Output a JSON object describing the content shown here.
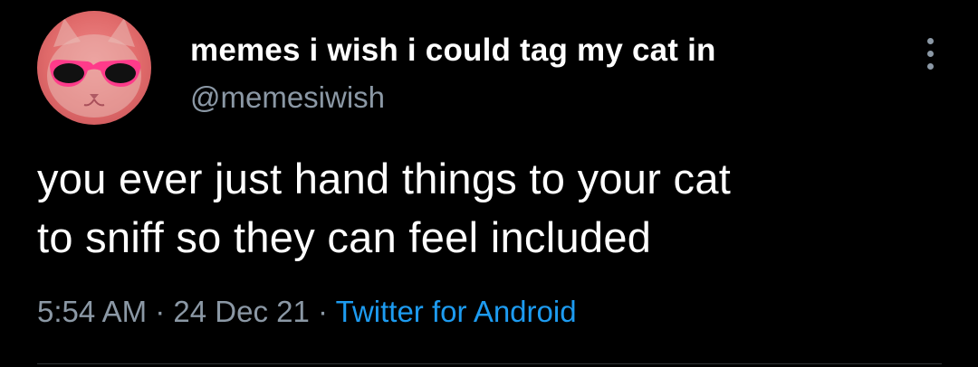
{
  "tweet": {
    "author_name": "memes i wish i could tag my cat in",
    "author_handle": "@memesiwish",
    "text_lines": [
      "you ever just hand things to your cat",
      "to sniff so they can feel included"
    ],
    "time": "5:54 AM",
    "separator": "·",
    "date": "24 Dec 21",
    "source": "Twitter for Android"
  },
  "icons": {
    "avatar": "cat-with-pink-sunglasses-avatar",
    "more": "more-options-icon"
  },
  "colors": {
    "background": "#000000",
    "name": "#ffffff",
    "secondary": "#8b98a5",
    "link": "#1d9bf0",
    "avatar_bg": "#e06a6a",
    "sunglasses": "#ff3b8a"
  }
}
